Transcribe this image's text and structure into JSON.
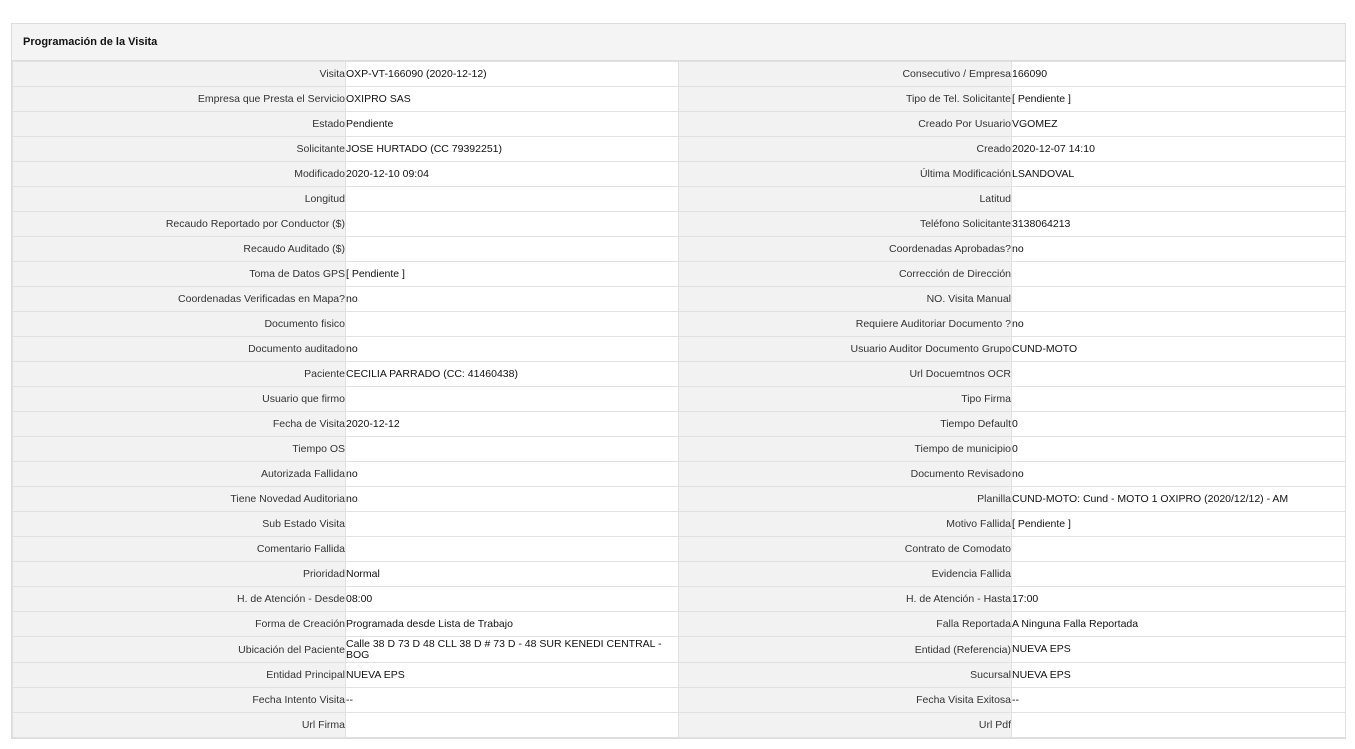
{
  "panel": {
    "title": "Programación de la Visita"
  },
  "rows": [
    {
      "l1": "Visita",
      "v1": "OXP-VT-166090 (2020-12-12)",
      "l2": "Consecutivo / Empresa",
      "v2": "166090"
    },
    {
      "l1": "Empresa que Presta el Servicio",
      "v1": "OXIPRO SAS",
      "l2": "Tipo de Tel. Solicitante",
      "v2": "[ Pendiente ]"
    },
    {
      "l1": "Estado",
      "v1": "Pendiente",
      "l2": "Creado Por Usuario",
      "v2": "VGOMEZ"
    },
    {
      "l1": "Solicitante",
      "v1": "JOSE HURTADO (CC 79392251)",
      "l2": "Creado",
      "v2": "2020-12-07 14:10"
    },
    {
      "l1": "Modificado",
      "v1": "2020-12-10 09:04",
      "l2": "Última Modificación",
      "v2": " LSANDOVAL"
    },
    {
      "l1": "Longitud",
      "v1": "",
      "l2": "Latitud",
      "v2": ""
    },
    {
      "l1": "Recaudo Reportado por Conductor ($)",
      "v1": "",
      "l2": "Teléfono Solicitante",
      "v2": "3138064213"
    },
    {
      "l1": "Recaudo Auditado ($)",
      "v1": "",
      "l2": "Coordenadas Aprobadas?",
      "v2": " no"
    },
    {
      "l1": "Toma de Datos GPS",
      "v1": "[ Pendiente ]",
      "l2": "Corrección de Dirección",
      "v2": ""
    },
    {
      "l1": "Coordenadas Verificadas en Mapa?",
      "v1": " no",
      "l2": "NO. Visita Manual",
      "v2": ""
    },
    {
      "l1": "Documento fisico",
      "v1": "",
      "l2": "Requiere Auditoriar Documento ?",
      "v2": " no"
    },
    {
      "l1": "Documento auditado",
      "v1": " no",
      "l2": "Usuario Auditor Documento Grupo",
      "v2": "CUND-MOTO"
    },
    {
      "l1": "Paciente",
      "v1": "CECILIA PARRADO (CC: 41460438)",
      "l2": "Url Docuemtnos OCR",
      "v2": ""
    },
    {
      "l1": "Usuario que firmo",
      "v1": "",
      "l2": "Tipo Firma",
      "v2": ""
    },
    {
      "l1": "Fecha de Visita",
      "v1": " 2020-12-12",
      "l2": "Tiempo Default",
      "v2": "0"
    },
    {
      "l1": "Tiempo OS",
      "v1": "",
      "l2": "Tiempo de municipio",
      "v2": "0"
    },
    {
      "l1": "Autorizada Fallida",
      "v1": " no",
      "l2": "Documento Revisado",
      "v2": " no"
    },
    {
      "l1": "Tiene Novedad Auditoria",
      "v1": " no",
      "l2": "Planilla",
      "v2": "CUND-MOTO: Cund - MOTO 1 OXIPRO (2020/12/12) - AM"
    },
    {
      "l1": "Sub Estado Visita",
      "v1": "",
      "l2": "Motivo Fallida",
      "v2": "[ Pendiente ]"
    },
    {
      "l1": "Comentario Fallida",
      "v1": "",
      "l2": "Contrato de Comodato",
      "v2": ""
    },
    {
      "l1": "Prioridad",
      "v1": "Normal",
      "l2": "Evidencia Fallida",
      "v2": ""
    },
    {
      "l1": "H. de Atención - Desde",
      "v1": "08:00",
      "l2": "H. de Atención - Hasta",
      "v2": "17:00"
    },
    {
      "l1": "Forma de Creación",
      "v1": "Programada desde Lista de Trabajo",
      "l2": "Falla Reportada",
      "v2": "A Ninguna Falla Reportada"
    },
    {
      "l1": "Ubicación del Paciente",
      "v1": "Calle 38 D 73 D 48 CLL 38 D # 73 D - 48 SUR KENEDI CENTRAL - BOG",
      "l2": "Entidad (Referencia)",
      "v2": "NUEVA EPS"
    },
    {
      "l1": "Entidad Principal",
      "v1": "NUEVA EPS",
      "l2": "Sucursal",
      "v2": "NUEVA EPS"
    },
    {
      "l1": "Fecha Intento Visita",
      "v1": " --",
      "l2": "Fecha Visita Exitosa",
      "v2": " --"
    },
    {
      "l1": "Url Firma",
      "v1": "",
      "l2": "Url Pdf",
      "v2": ""
    }
  ]
}
